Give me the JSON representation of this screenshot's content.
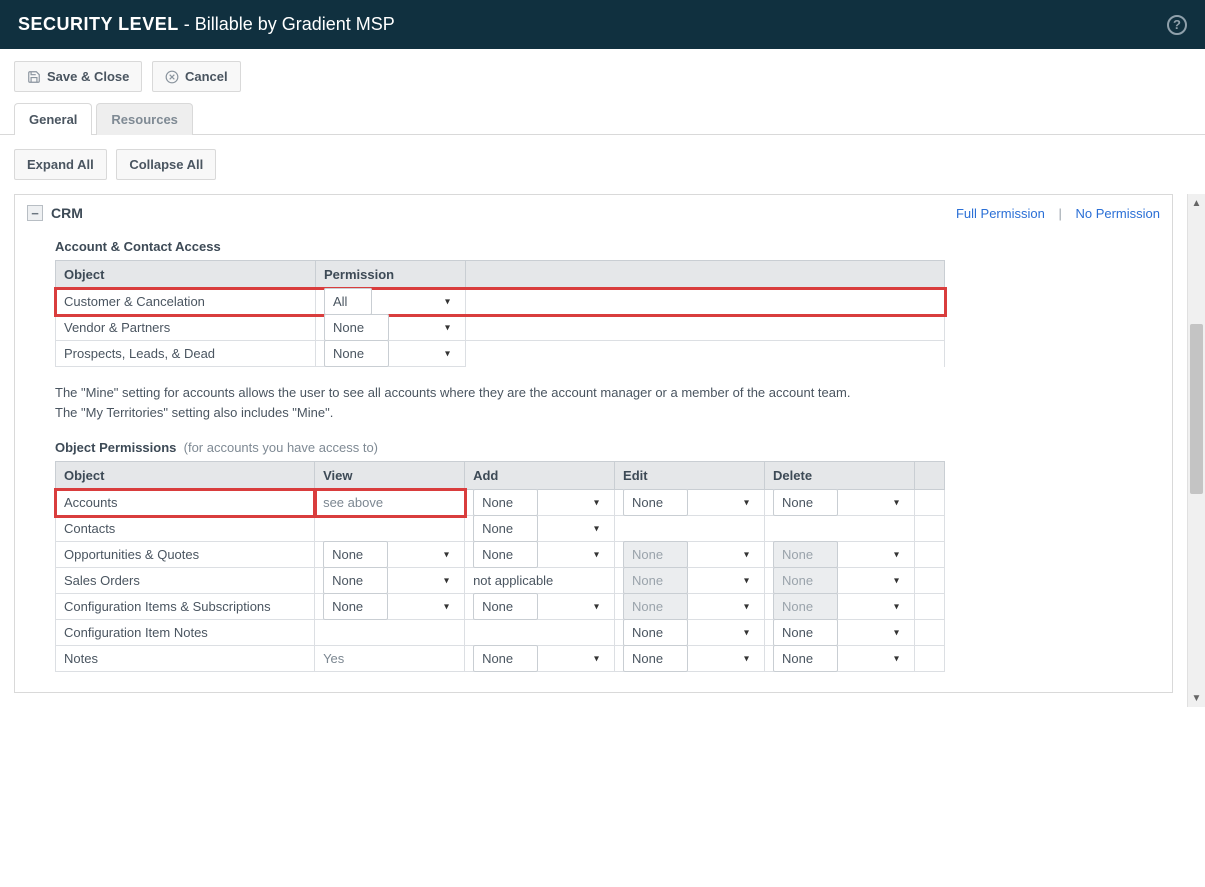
{
  "header": {
    "title_strong": "SECURITY LEVEL",
    "title_rest": " - Billable by Gradient MSP"
  },
  "toolbar": {
    "save_close": "Save & Close",
    "cancel": "Cancel"
  },
  "tabs": {
    "general": "General",
    "resources": "Resources"
  },
  "actions": {
    "expand_all": "Expand All",
    "collapse_all": "Collapse All"
  },
  "section": {
    "crm": "CRM",
    "full_permission": "Full Permission",
    "no_permission": "No Permission"
  },
  "account_access": {
    "title": "Account & Contact Access",
    "cols": {
      "object": "Object",
      "permission": "Permission"
    },
    "rows": [
      {
        "object": "Customer & Cancelation",
        "permission": "All"
      },
      {
        "object": "Vendor & Partners",
        "permission": "None"
      },
      {
        "object": "Prospects, Leads, & Dead",
        "permission": "None"
      }
    ]
  },
  "note": {
    "line1": "The \"Mine\" setting for accounts allows the user to see all accounts where they are the account manager or a member of the account team.",
    "line2": "The \"My Territories\" setting also includes \"Mine\"."
  },
  "object_permissions": {
    "title": "Object Permissions",
    "subtitle": "(for accounts you have access to)",
    "cols": {
      "object": "Object",
      "view": "View",
      "add": "Add",
      "edit": "Edit",
      "delete": "Delete"
    },
    "rows": [
      {
        "object": "Accounts",
        "view_text": "see above",
        "add": "None",
        "edit": "None",
        "delete": "None",
        "edit_disabled": false,
        "delete_disabled": false
      },
      {
        "object": "Contacts",
        "view_text": "",
        "add": "None",
        "edit": "",
        "delete": "",
        "edit_disabled": false,
        "delete_disabled": false
      },
      {
        "object": "Opportunities & Quotes",
        "view": "None",
        "add": "None",
        "edit": "None",
        "delete": "None",
        "edit_disabled": true,
        "delete_disabled": true
      },
      {
        "object": "Sales Orders",
        "view": "None",
        "add_text": "not applicable",
        "edit": "None",
        "delete": "None",
        "edit_disabled": true,
        "delete_disabled": true
      },
      {
        "object": "Configuration Items & Subscriptions",
        "view": "None",
        "add": "None",
        "edit": "None",
        "delete": "None",
        "edit_disabled": true,
        "delete_disabled": true
      },
      {
        "object": "Configuration Item Notes",
        "view_text": "",
        "add": "",
        "edit": "None",
        "delete": "None",
        "edit_disabled": false,
        "delete_disabled": false
      },
      {
        "object": "Notes",
        "view_text": "Yes",
        "add": "None",
        "edit": "None",
        "delete": "None",
        "edit_disabled": false,
        "delete_disabled": false
      }
    ]
  }
}
